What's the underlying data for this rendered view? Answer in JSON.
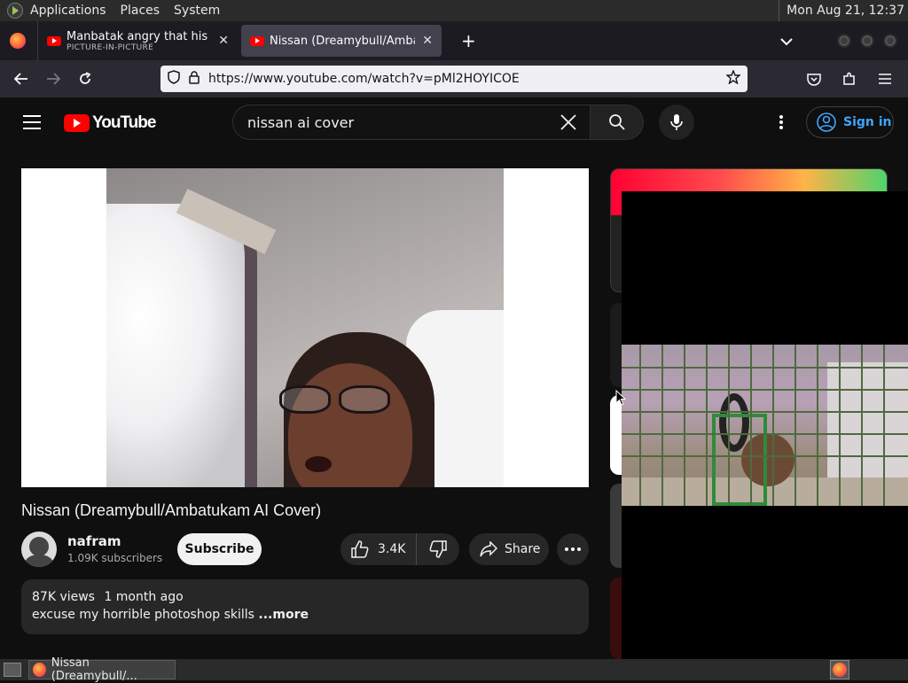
{
  "os": {
    "menu": [
      "Applications",
      "Places",
      "System"
    ],
    "clock": "Mon Aug 21, 12:37"
  },
  "browser": {
    "tabs": [
      {
        "title": "Manbatak angry that his cag",
        "subtitle": "PICTURE-IN-PICTURE",
        "active": false
      },
      {
        "title": "Nissan (Dreamybull/Ambatu",
        "active": true
      }
    ],
    "url": "https://www.youtube.com/watch?v=pMl2HOYICOE"
  },
  "youtube": {
    "logo_text": "YouTube",
    "search_value": "nissan ai cover",
    "signin_label": "Sign in",
    "video": {
      "title": "Nissan (Dreamybull/Ambatukam AI Cover)",
      "channel": "nafram",
      "subscribers": "1.09K subscribers",
      "subscribe_label": "Subscribe",
      "likes": "3.4K",
      "share_label": "Share",
      "views": "87K views",
      "age": "1 month ago",
      "description": "excuse my horrible photoshop skills",
      "more_label": "...more"
    }
  },
  "taskbar": {
    "window_title": "Nissan (Dreamybull/..."
  },
  "colors": {
    "yt_red": "#ff0000",
    "link_blue": "#3ea6ff",
    "bg": "#0f0f0f"
  }
}
